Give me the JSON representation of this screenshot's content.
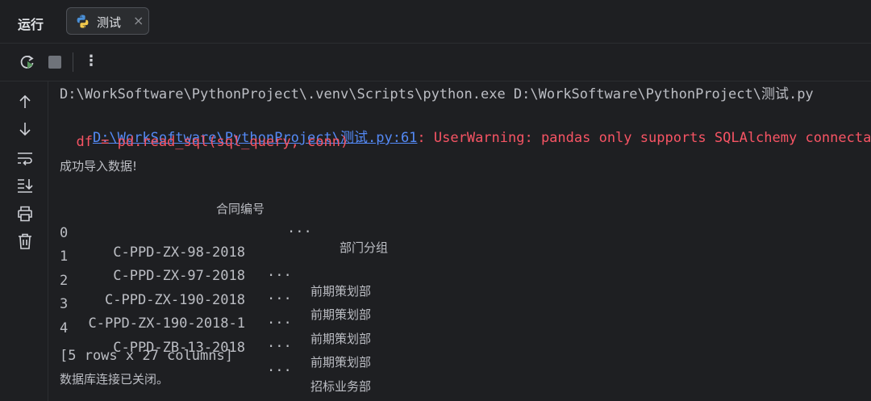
{
  "panel": {
    "title": "运行"
  },
  "tab": {
    "label": "测试",
    "close": "×"
  },
  "colors": {
    "background": "#1e1f22",
    "text": "#bcbec4",
    "link": "#548af7",
    "warning": "#f75464"
  },
  "toolbar": {
    "rerun_icon": "rerun-icon",
    "stop_icon": "stop-icon",
    "more_label": "⋮"
  },
  "gutter": {
    "icons": [
      "arrow-up-icon",
      "arrow-down-icon",
      "soft-wrap-icon",
      "scroll-to-end-icon",
      "print-icon",
      "trash-icon"
    ]
  },
  "console": {
    "command": "D:\\WorkSoftware\\PythonProject\\.venv\\Scripts\\python.exe D:\\WorkSoftware\\PythonProject\\测试.py",
    "warning_link": "D:\\WorkSoftware\\PythonProject\\测试.py:61",
    "warning_text": ": UserWarning: pandas only supports SQLAlchemy connecta",
    "warning_code": "  df = pd.read_sql(sql_query, conn)",
    "import_success": "成功导入数据!",
    "table_header": {
      "contract_no": "合同编号",
      "ellipsis": "...",
      "department": "部门分组"
    },
    "rows": [
      {
        "index": "0",
        "contract": "C-PPD-ZX-98-2018",
        "ellipsis": "...",
        "department": "前期策划部"
      },
      {
        "index": "1",
        "contract": "C-PPD-ZX-97-2018",
        "ellipsis": "...",
        "department": "前期策划部"
      },
      {
        "index": "2",
        "contract": "C-PPD-ZX-190-2018",
        "ellipsis": "...",
        "department": "前期策划部"
      },
      {
        "index": "3",
        "contract": "C-PPD-ZX-190-2018-1",
        "ellipsis": "...",
        "department": "前期策划部"
      },
      {
        "index": "4",
        "contract": "C-PPD-ZB-13-2018",
        "ellipsis": "...",
        "department": "招标业务部"
      }
    ],
    "summary": "[5 rows x 27 columns]",
    "closed": "数据库连接已关闭。"
  }
}
